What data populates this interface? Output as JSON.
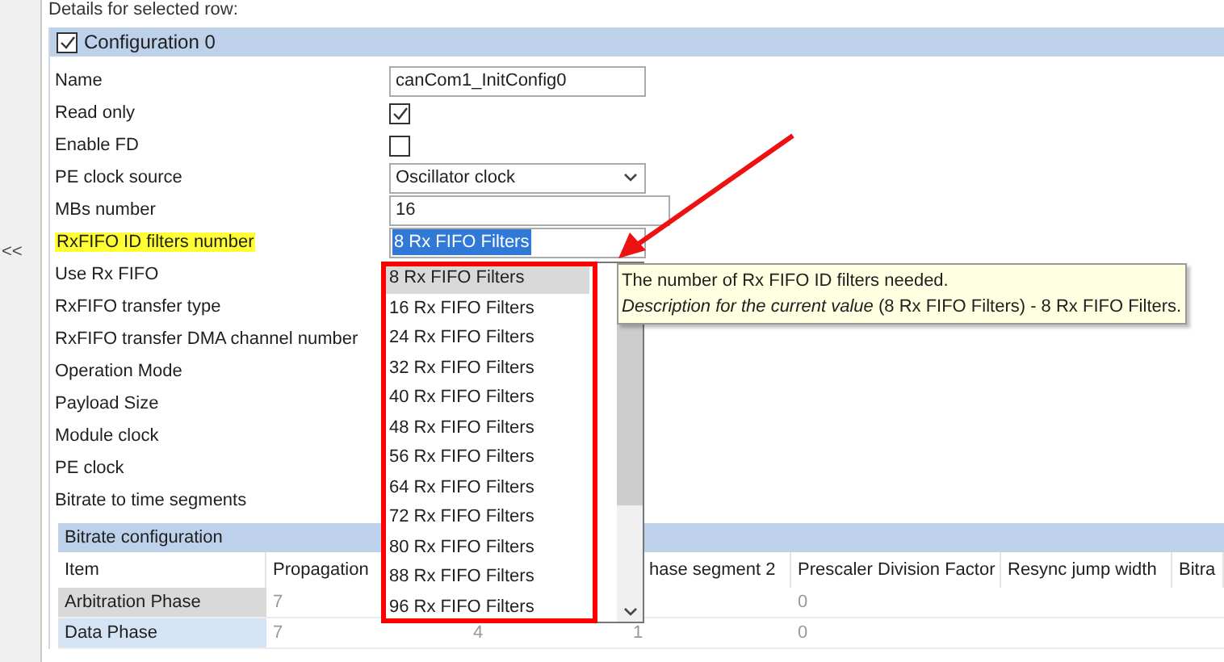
{
  "heading": "Details for selected row:",
  "collapse_label": "<<",
  "group": {
    "title": "Configuration 0",
    "checked": true
  },
  "fields": [
    {
      "label": "Name",
      "kind": "text",
      "value": "canCom1_InitConfig0"
    },
    {
      "label": "Read only",
      "kind": "checkbox",
      "checked": true
    },
    {
      "label": "Enable FD",
      "kind": "checkbox",
      "checked": false
    },
    {
      "label": "PE clock source",
      "kind": "select",
      "value": "Oscillator clock"
    },
    {
      "label": "MBs number",
      "kind": "number",
      "value": "16"
    },
    {
      "label": "RxFIFO ID filters number",
      "kind": "combo",
      "value": "8 Rx FIFO Filters",
      "highlighted": true
    },
    {
      "label": "Use Rx FIFO",
      "kind": "plain"
    },
    {
      "label": "RxFIFO transfer type",
      "kind": "plain"
    },
    {
      "label": "RxFIFO transfer DMA channel number",
      "kind": "plain"
    },
    {
      "label": "Operation Mode",
      "kind": "plain"
    },
    {
      "label": "Payload Size",
      "kind": "plain"
    },
    {
      "label": "Module clock",
      "kind": "plain"
    },
    {
      "label": "PE clock",
      "kind": "plain"
    },
    {
      "label": "Bitrate to time segments",
      "kind": "plain"
    }
  ],
  "bitrate": {
    "title": "Bitrate configuration",
    "columns": [
      "Item",
      "Propagation",
      "",
      "hase segment 2",
      "Prescaler Division Factor",
      "Resync jump width",
      "Bitra"
    ],
    "rows": [
      {
        "cells": [
          "Arbitration Phase",
          "7",
          "",
          "",
          "0",
          "",
          ""
        ],
        "selected": false
      },
      {
        "cells": [
          "Data Phase",
          "7",
          "4",
          "1",
          "0",
          "",
          ""
        ],
        "selected": true
      }
    ]
  },
  "dropdown": {
    "options": [
      {
        "label": "8 Rx FIFO Filters",
        "selected": true
      },
      {
        "label": "16 Rx FIFO Filters",
        "selected": false
      },
      {
        "label": "24 Rx FIFO Filters",
        "selected": false
      },
      {
        "label": "32 Rx FIFO Filters",
        "selected": false
      },
      {
        "label": "40 Rx FIFO Filters",
        "selected": false
      },
      {
        "label": "48 Rx FIFO Filters",
        "selected": false
      },
      {
        "label": "56 Rx FIFO Filters",
        "selected": false
      },
      {
        "label": "64 Rx FIFO Filters",
        "selected": false
      },
      {
        "label": "72 Rx FIFO Filters",
        "selected": false
      },
      {
        "label": "80 Rx FIFO Filters",
        "selected": false
      },
      {
        "label": "88 Rx FIFO Filters",
        "selected": false
      },
      {
        "label": "96 Rx FIFO Filters",
        "selected": false
      }
    ]
  },
  "tooltip": {
    "line_1": "The number of Rx FIFO ID filters needed.",
    "line_2": "*Description for the current value* (8 Rx FIFO Filters) - 8 Rx FIFO Filters."
  }
}
